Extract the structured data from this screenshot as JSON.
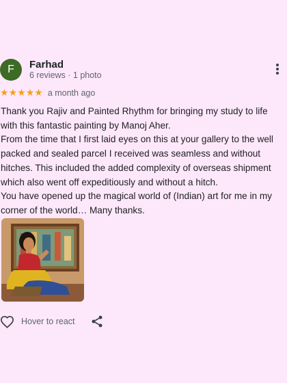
{
  "review": {
    "avatar_initial": "F",
    "reviewer_name": "Farhad",
    "reviewer_meta": "6 reviews · 1 photo",
    "star_glyph": "★",
    "rating_stars": 5,
    "date": "a month ago",
    "paragraphs": [
      "Thank you Rajiv and Painted Rhythm for bringing my study to life with this fantastic painting by Manoj Aher.",
      "From the time that I first laid eyes on this at your gallery to the well packed and sealed parcel I received was seamless and without hitches. This included the added complexity of overseas shipment which also went off expeditiously and without a hitch.",
      "You have opened up the magical world of (Indian) art for me in my corner of the world… Many thanks."
    ],
    "react_label": "Hover to react",
    "colors": {
      "background": "#fde8fb",
      "avatar": "#3b6b24",
      "star": "#f4a11c",
      "secondary_text": "#5f6368"
    },
    "icons": {
      "react": "heart-outline-icon",
      "share": "share-icon",
      "menu": "more-vertical-icon"
    }
  }
}
